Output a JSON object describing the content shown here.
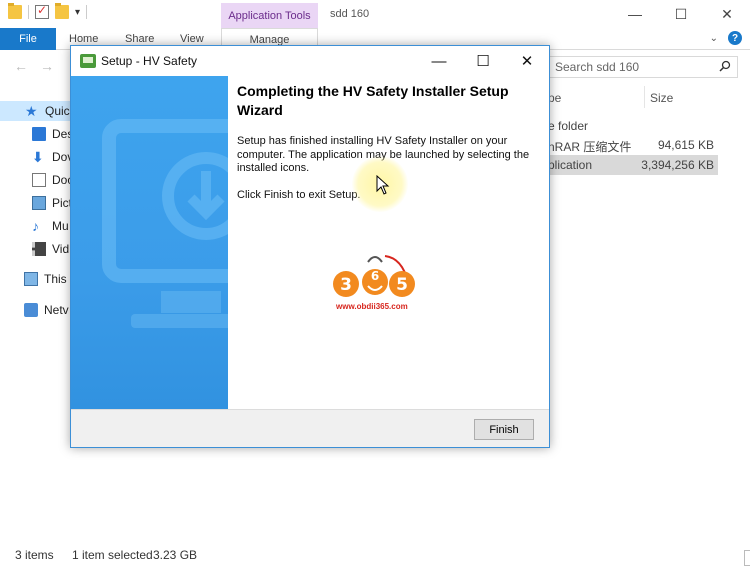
{
  "explorer": {
    "title": "sdd 160",
    "context_tab": "Application Tools",
    "tabs": {
      "file": "File",
      "home": "Home",
      "share": "Share",
      "view": "View",
      "manage": "Manage"
    },
    "search": {
      "placeholder": "Search sdd 160"
    },
    "sidebar": {
      "items": [
        {
          "label": "Quic"
        },
        {
          "label": "Des"
        },
        {
          "label": "Dov"
        },
        {
          "label": "Doc"
        },
        {
          "label": "Pict"
        },
        {
          "label": "Mu"
        },
        {
          "label": "Vid"
        },
        {
          "label": "This"
        },
        {
          "label": "Netv"
        }
      ]
    },
    "columns": {
      "type": "pe",
      "size": "Size"
    },
    "files": [
      {
        "type": "e folder",
        "size": ""
      },
      {
        "type": "nRAR 压缩文件",
        "size": "94,615 KB"
      },
      {
        "type": "plication",
        "size": "3,394,256 KB"
      }
    ],
    "status": {
      "items": "3 items",
      "selected": "1 item selected",
      "size": "3.23 GB"
    }
  },
  "dialog": {
    "title": "Setup - HV Safety",
    "heading": "Completing the HV Safety Installer Setup Wizard",
    "body": "Setup has finished installing HV Safety Installer on your computer. The application may be launched by selecting the installed icons.",
    "body2": "Click Finish to exit Setup.",
    "finish_label": "Finish"
  },
  "watermark": {
    "digits": [
      "3",
      "6",
      "5"
    ],
    "url": "www.obdii365.com"
  },
  "colors": {
    "accent": "#1979ca",
    "banner": "#3b9ce9",
    "context_tab_bg": "#ead6f5",
    "selection": "#cce8ff"
  }
}
